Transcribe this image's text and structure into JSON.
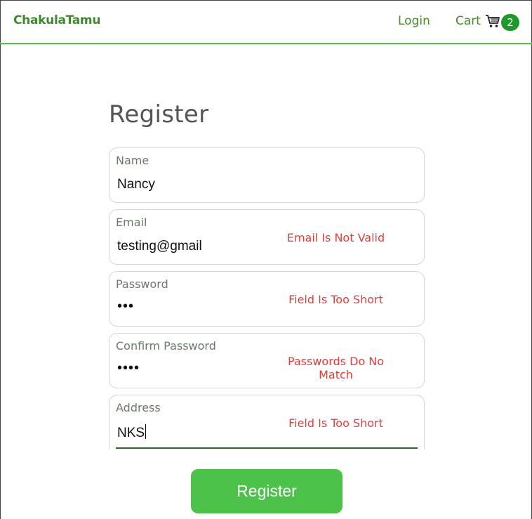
{
  "navbar": {
    "brand": "ChakulaTamu",
    "login_label": "Login",
    "cart_label": "Cart",
    "cart_count": "2"
  },
  "form": {
    "title": "Register",
    "fields": [
      {
        "label": "Name",
        "value": "Nancy",
        "error": ""
      },
      {
        "label": "Email",
        "value": "testing@gmail",
        "error": "Email Is Not Valid"
      },
      {
        "label": "Password",
        "value": "•••",
        "error": "Field Is Too Short"
      },
      {
        "label": "Confirm Password",
        "value": "••••",
        "error": "Passwords Do No Match"
      },
      {
        "label": "Address",
        "value": "NKS",
        "error": "Field Is Too Short"
      }
    ],
    "submit_label": "Register"
  },
  "colors": {
    "accent": "#4cc24a",
    "brand": "#3d8a2a",
    "error": "#e0403c",
    "badge": "#1f9a2a"
  },
  "icons": {
    "cart": "shopping-cart-icon"
  }
}
